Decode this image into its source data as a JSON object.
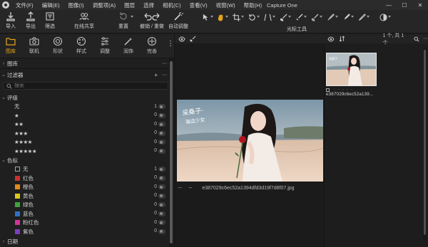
{
  "menu": [
    "文件(F)",
    "编辑(E)",
    "图像(I)",
    "调整项(A)",
    "图层",
    "选择",
    "相机(C)",
    "查看(V)",
    "视窗(W)",
    "帮助(H)"
  ],
  "app_title": "Capture One",
  "window_controls": {
    "minimize": "—",
    "maximize": "☐",
    "close": "✕"
  },
  "toolbar": {
    "import": "导入",
    "export": "导出",
    "filter": "筛选",
    "online_share": "在线共享",
    "reset": "重置",
    "undo_redo": "撤销 / 重做",
    "auto_adjust": "自动调整",
    "cursor_tools": "光标工具"
  },
  "tool_tabs": [
    {
      "label": "图库",
      "icon": "folder-icon",
      "active": true
    },
    {
      "label": "联机",
      "icon": "camera-icon",
      "active": false
    },
    {
      "label": "形状",
      "icon": "lens-icon",
      "active": false
    },
    {
      "label": "样式",
      "icon": "palette-icon",
      "active": false
    },
    {
      "label": "调整",
      "icon": "sliders-icon",
      "active": false
    },
    {
      "label": "润饰",
      "icon": "wand-icon",
      "active": false
    },
    {
      "label": "完善",
      "icon": "sparkle-icon",
      "active": false
    }
  ],
  "left_panel": {
    "library_title": "图库",
    "filter_title": "过滤器",
    "search_placeholder": "搜索",
    "rating_title": "评级",
    "rating_none": "无",
    "ratings": [
      {
        "stars": "★",
        "count": "0"
      },
      {
        "stars": "★★",
        "count": "0"
      },
      {
        "stars": "★★★",
        "count": "0"
      },
      {
        "stars": "★★★★",
        "count": "0"
      },
      {
        "stars": "★★★★★",
        "count": "0"
      }
    ],
    "rating_none_count": "1",
    "color_title": "色标",
    "colors": [
      {
        "label": "无",
        "color": "",
        "count": "1"
      },
      {
        "label": "红色",
        "color": "#c8322d",
        "count": "0"
      },
      {
        "label": "橙色",
        "color": "#e38a1a",
        "count": "0"
      },
      {
        "label": "黄色",
        "color": "#d9c81a",
        "count": "0"
      },
      {
        "label": "绿色",
        "color": "#3fa33a",
        "count": "0"
      },
      {
        "label": "蓝色",
        "color": "#2f6fc8",
        "count": "0"
      },
      {
        "label": "粉红色",
        "color": "#d2349a",
        "count": "0"
      },
      {
        "label": "紫色",
        "color": "#7a3fc0",
        "count": "0"
      }
    ],
    "date_title": "日期"
  },
  "viewer": {
    "filename": "e387029c6ec52a1394dfd3d19f7d8f07.jpg",
    "left_dots": "--",
    "right_dots": "--"
  },
  "browser": {
    "count_text": "1 个, 共 1 个",
    "thumb_name": "e387029c6ec52a139..."
  },
  "colors": {
    "accent": "#e4a51a",
    "background": "#1b1b1b"
  }
}
